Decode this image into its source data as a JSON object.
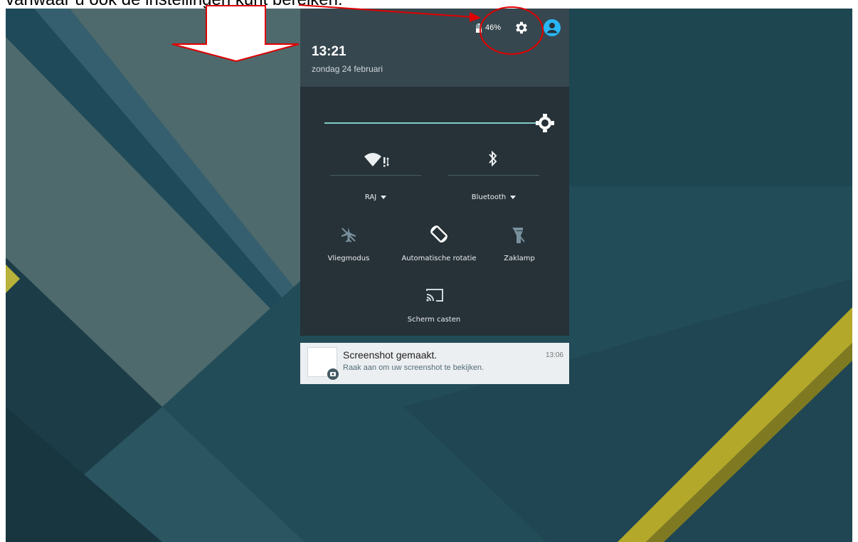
{
  "caption": {
    "text": "vanwaar u ook de instellingen kunt bereiken."
  },
  "header": {
    "battery": "46%",
    "time": "13:21",
    "date": "zondag 24 februari"
  },
  "quick_settings": {
    "brightness_level": 1.0,
    "wifi_label": "RAJ",
    "bluetooth_label": "Bluetooth",
    "airplane_label": "Vliegmodus",
    "rotation_label": "Automatische rotatie",
    "flashlight_label": "Zaklamp",
    "cast_label": "Scherm casten"
  },
  "notification": {
    "title": "Screenshot gemaakt.",
    "subtitle": "Raak aan om uw screenshot te bekijken.",
    "time": "13:06"
  },
  "colors": {
    "accent": "#80cbc4",
    "annotation": "#e00000",
    "panel_header": "#37474f",
    "panel_body": "#263238",
    "wallpaper_base": "#1e4651"
  },
  "icons": [
    "battery-icon",
    "gear-icon",
    "avatar-icon",
    "brightness-icon",
    "wifi-icon",
    "bluetooth-icon",
    "airplane-icon",
    "rotation-icon",
    "flashlight-icon",
    "cast-icon",
    "screenshot-badge-icon"
  ]
}
